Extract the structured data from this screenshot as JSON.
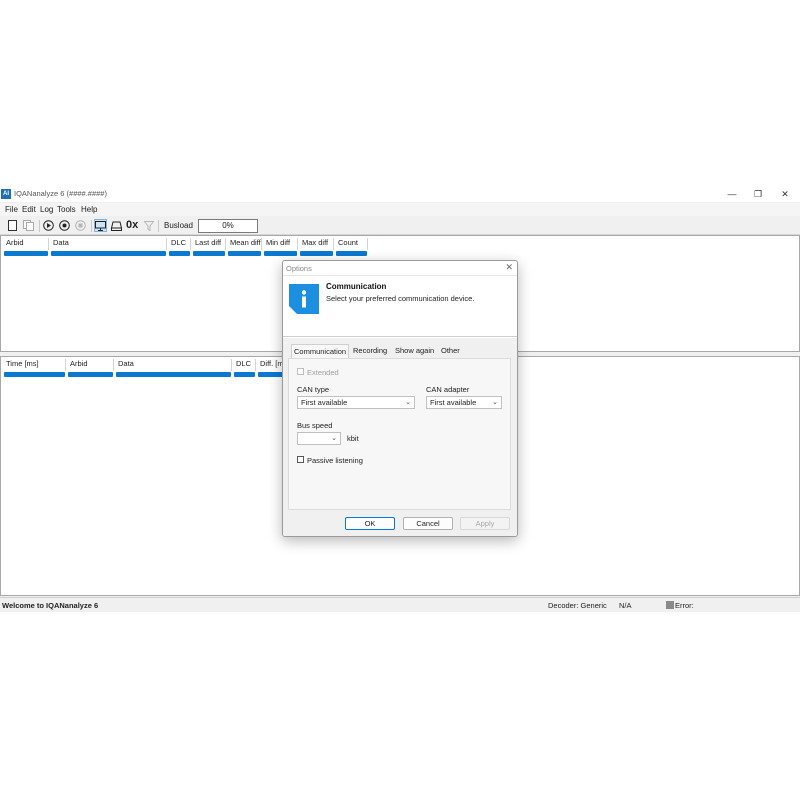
{
  "window": {
    "logo": "AI",
    "title": "IQANanalyze 6 (####.####)",
    "minimize": "—",
    "maximize": "❐",
    "close": "✕"
  },
  "menu": [
    "File",
    "Edit",
    "Log",
    "Tools",
    "Help"
  ],
  "toolbar": {
    "hex_label": "0x",
    "busload_label": "Busload",
    "busload_value": "0%"
  },
  "upper_grid": {
    "columns": [
      "Arbid",
      "Data",
      "DLC",
      "Last diff",
      "Mean diff",
      "Min diff",
      "Max diff",
      "Count"
    ]
  },
  "lower_grid": {
    "columns": [
      "Time [ms]",
      "Arbid",
      "Data",
      "DLC",
      "Diff. [ms]"
    ]
  },
  "status": {
    "message": "Welcome to IQANanalyze 6",
    "decoder": "Decoder: Generic",
    "value": "N/A",
    "error": "Error:"
  },
  "dialog": {
    "title": "Options",
    "close": "✕",
    "header_title": "Communication",
    "header_subtitle": "Select your preferred communication device.",
    "tabs": [
      "Communication",
      "Recording",
      "Show again",
      "Other"
    ],
    "active_tab": "Communication",
    "extended_label": "Extended",
    "can_type_label": "CAN type",
    "can_type_value": "First available",
    "can_adapter_label": "CAN adapter",
    "can_adapter_value": "First available",
    "bus_speed_label": "Bus speed",
    "bus_speed_value": "",
    "bus_speed_unit": "kbit",
    "passive_label": "Passive listening",
    "ok": "OK",
    "cancel": "Cancel",
    "apply": "Apply"
  },
  "colors": {
    "accent": "#0b79d0",
    "info_icon": "#1d8fe0"
  }
}
